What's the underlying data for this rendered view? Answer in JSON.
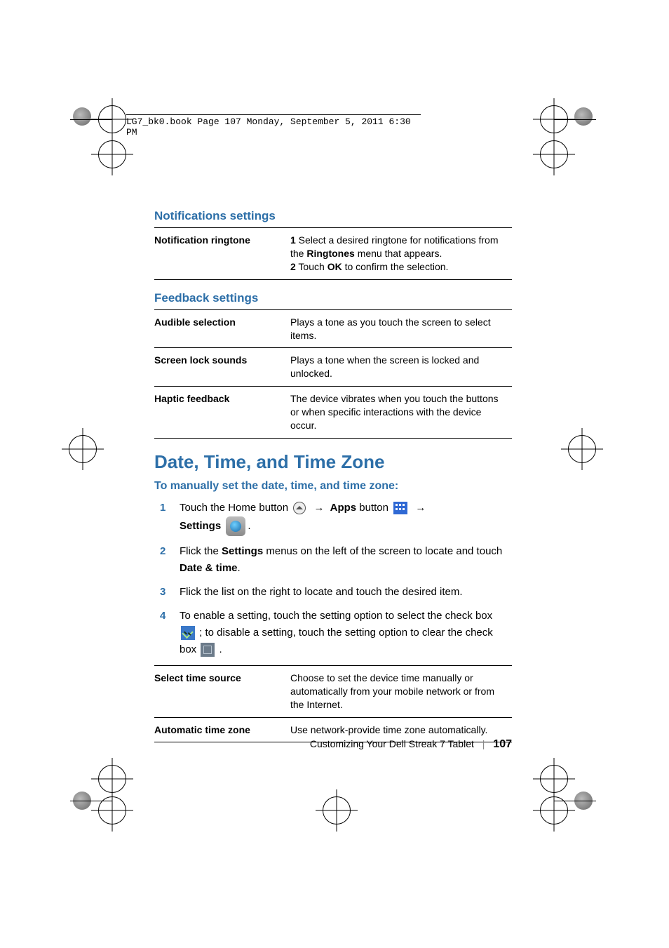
{
  "header_line": "LG7_bk0.book  Page 107  Monday, September 5, 2011  6:30 PM",
  "sections": {
    "notifications": {
      "heading": "Notifications settings",
      "rows": [
        {
          "label": "Notification ringtone",
          "step1_num": "1",
          "step1_a": " Select a desired ringtone for notifications from the ",
          "step1_bold": "Ringtones",
          "step1_b": " menu that appears.",
          "step2_num": "2",
          "step2_a": " Touch ",
          "step2_bold": "OK",
          "step2_b": " to confirm the selection."
        }
      ]
    },
    "feedback": {
      "heading": "Feedback settings",
      "rows": [
        {
          "label": "Audible selection",
          "desc": "Plays a tone as you touch the screen to select items."
        },
        {
          "label": "Screen lock sounds",
          "desc": "Plays a tone when the screen is locked and unlocked."
        },
        {
          "label": "Haptic feedback",
          "desc": "The device vibrates when you touch the buttons or when specific interactions with the device occur."
        }
      ]
    }
  },
  "main_heading": "Date, Time, and Time Zone",
  "sub_heading": "To manually set the date, time, and time zone:",
  "steps": {
    "s1": {
      "num": "1",
      "a": "Touch the Home button ",
      "apps": "Apps",
      "b": " button ",
      "settings": "Settings",
      "period": "."
    },
    "s2": {
      "num": "2",
      "a": "Flick the ",
      "b1": "Settings",
      "c": " menus on the left of the screen to locate and touch ",
      "b2": "Date & time",
      "d": "."
    },
    "s3": {
      "num": "3",
      "a": "Flick the list on the right to locate and touch the desired item."
    },
    "s4": {
      "num": "4",
      "a": "To enable a setting, touch the setting option to select the check box ",
      "b": " ; to disable a setting, touch the setting option to clear the check box ",
      "c": " ."
    }
  },
  "time_table": {
    "rows": [
      {
        "label": "Select time source",
        "desc": "Choose to set the device time manually or automatically from your mobile network or from the Internet."
      },
      {
        "label": "Automatic time zone",
        "desc": "Use network-provide time zone automatically."
      }
    ]
  },
  "footer": {
    "section": "Customizing Your Dell Streak 7 Tablet",
    "page": "107"
  }
}
